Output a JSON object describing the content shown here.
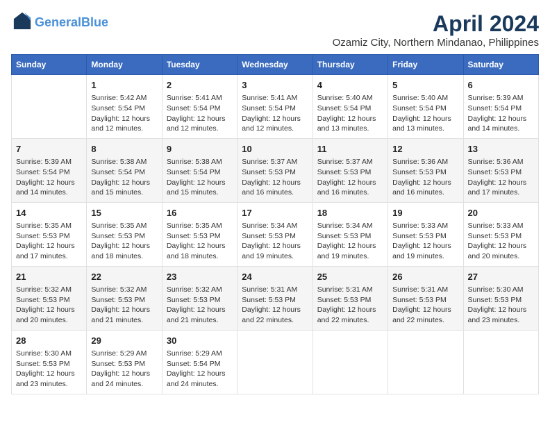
{
  "header": {
    "logo_line1": "General",
    "logo_line2": "Blue",
    "main_title": "April 2024",
    "subtitle": "Ozamiz City, Northern Mindanao, Philippines"
  },
  "weekdays": [
    "Sunday",
    "Monday",
    "Tuesday",
    "Wednesday",
    "Thursday",
    "Friday",
    "Saturday"
  ],
  "weeks": [
    [
      {
        "day": "",
        "content": ""
      },
      {
        "day": "1",
        "content": "Sunrise: 5:42 AM\nSunset: 5:54 PM\nDaylight: 12 hours\nand 12 minutes."
      },
      {
        "day": "2",
        "content": "Sunrise: 5:41 AM\nSunset: 5:54 PM\nDaylight: 12 hours\nand 12 minutes."
      },
      {
        "day": "3",
        "content": "Sunrise: 5:41 AM\nSunset: 5:54 PM\nDaylight: 12 hours\nand 12 minutes."
      },
      {
        "day": "4",
        "content": "Sunrise: 5:40 AM\nSunset: 5:54 PM\nDaylight: 12 hours\nand 13 minutes."
      },
      {
        "day": "5",
        "content": "Sunrise: 5:40 AM\nSunset: 5:54 PM\nDaylight: 12 hours\nand 13 minutes."
      },
      {
        "day": "6",
        "content": "Sunrise: 5:39 AM\nSunset: 5:54 PM\nDaylight: 12 hours\nand 14 minutes."
      }
    ],
    [
      {
        "day": "7",
        "content": "Sunrise: 5:39 AM\nSunset: 5:54 PM\nDaylight: 12 hours\nand 14 minutes."
      },
      {
        "day": "8",
        "content": "Sunrise: 5:38 AM\nSunset: 5:54 PM\nDaylight: 12 hours\nand 15 minutes."
      },
      {
        "day": "9",
        "content": "Sunrise: 5:38 AM\nSunset: 5:54 PM\nDaylight: 12 hours\nand 15 minutes."
      },
      {
        "day": "10",
        "content": "Sunrise: 5:37 AM\nSunset: 5:53 PM\nDaylight: 12 hours\nand 16 minutes."
      },
      {
        "day": "11",
        "content": "Sunrise: 5:37 AM\nSunset: 5:53 PM\nDaylight: 12 hours\nand 16 minutes."
      },
      {
        "day": "12",
        "content": "Sunrise: 5:36 AM\nSunset: 5:53 PM\nDaylight: 12 hours\nand 16 minutes."
      },
      {
        "day": "13",
        "content": "Sunrise: 5:36 AM\nSunset: 5:53 PM\nDaylight: 12 hours\nand 17 minutes."
      }
    ],
    [
      {
        "day": "14",
        "content": "Sunrise: 5:35 AM\nSunset: 5:53 PM\nDaylight: 12 hours\nand 17 minutes."
      },
      {
        "day": "15",
        "content": "Sunrise: 5:35 AM\nSunset: 5:53 PM\nDaylight: 12 hours\nand 18 minutes."
      },
      {
        "day": "16",
        "content": "Sunrise: 5:35 AM\nSunset: 5:53 PM\nDaylight: 12 hours\nand 18 minutes."
      },
      {
        "day": "17",
        "content": "Sunrise: 5:34 AM\nSunset: 5:53 PM\nDaylight: 12 hours\nand 19 minutes."
      },
      {
        "day": "18",
        "content": "Sunrise: 5:34 AM\nSunset: 5:53 PM\nDaylight: 12 hours\nand 19 minutes."
      },
      {
        "day": "19",
        "content": "Sunrise: 5:33 AM\nSunset: 5:53 PM\nDaylight: 12 hours\nand 19 minutes."
      },
      {
        "day": "20",
        "content": "Sunrise: 5:33 AM\nSunset: 5:53 PM\nDaylight: 12 hours\nand 20 minutes."
      }
    ],
    [
      {
        "day": "21",
        "content": "Sunrise: 5:32 AM\nSunset: 5:53 PM\nDaylight: 12 hours\nand 20 minutes."
      },
      {
        "day": "22",
        "content": "Sunrise: 5:32 AM\nSunset: 5:53 PM\nDaylight: 12 hours\nand 21 minutes."
      },
      {
        "day": "23",
        "content": "Sunrise: 5:32 AM\nSunset: 5:53 PM\nDaylight: 12 hours\nand 21 minutes."
      },
      {
        "day": "24",
        "content": "Sunrise: 5:31 AM\nSunset: 5:53 PM\nDaylight: 12 hours\nand 22 minutes."
      },
      {
        "day": "25",
        "content": "Sunrise: 5:31 AM\nSunset: 5:53 PM\nDaylight: 12 hours\nand 22 minutes."
      },
      {
        "day": "26",
        "content": "Sunrise: 5:31 AM\nSunset: 5:53 PM\nDaylight: 12 hours\nand 22 minutes."
      },
      {
        "day": "27",
        "content": "Sunrise: 5:30 AM\nSunset: 5:53 PM\nDaylight: 12 hours\nand 23 minutes."
      }
    ],
    [
      {
        "day": "28",
        "content": "Sunrise: 5:30 AM\nSunset: 5:53 PM\nDaylight: 12 hours\nand 23 minutes."
      },
      {
        "day": "29",
        "content": "Sunrise: 5:29 AM\nSunset: 5:53 PM\nDaylight: 12 hours\nand 24 minutes."
      },
      {
        "day": "30",
        "content": "Sunrise: 5:29 AM\nSunset: 5:54 PM\nDaylight: 12 hours\nand 24 minutes."
      },
      {
        "day": "",
        "content": ""
      },
      {
        "day": "",
        "content": ""
      },
      {
        "day": "",
        "content": ""
      },
      {
        "day": "",
        "content": ""
      }
    ]
  ]
}
